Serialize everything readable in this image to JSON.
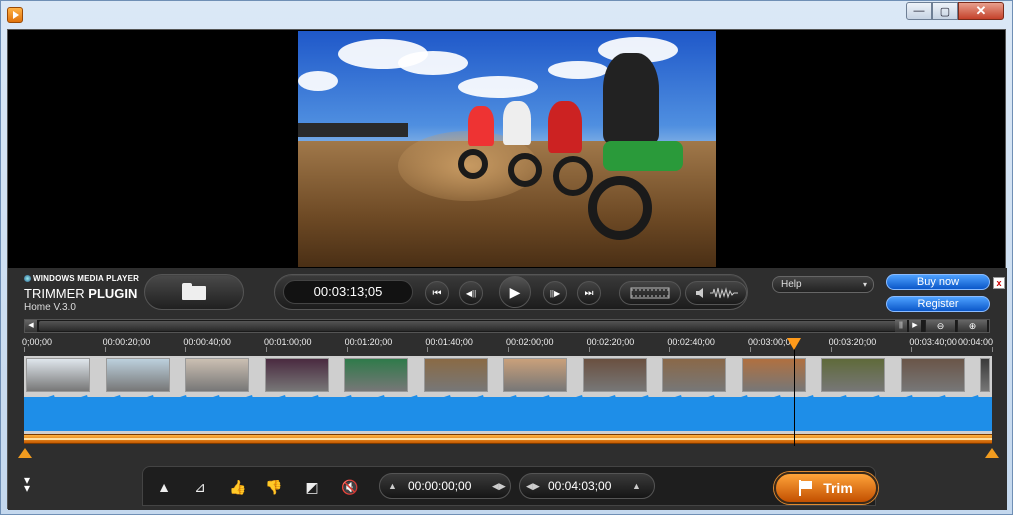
{
  "window": {
    "minimize_glyph": "—",
    "maximize_glyph": "▢",
    "close_glyph": "✕",
    "app_icon": "play-icon"
  },
  "branding": {
    "small": "WINDOWS MEDIA PLAYER",
    "title_light": "TRIMMER ",
    "title_bold": "PLUGIN",
    "version": "Home V.3.0"
  },
  "player": {
    "timecode": "00:03:13;05",
    "open_icon": "folder-icon"
  },
  "transport": {
    "skip_back": "⏮",
    "step_back": "◀||",
    "play": "▶",
    "step_forward": "||▶",
    "skip_forward": "⏭",
    "frame_mode_icon": "filmstrip-icon",
    "audio_mode_icon": "waveform-icon"
  },
  "menu": {
    "help_label": "Help",
    "help_caret": "▾",
    "buy_label": "Buy now",
    "register_label": "Register",
    "close_label": "x"
  },
  "timeline": {
    "ruler_labels": [
      "0;00;00",
      "00:00:20;00",
      "00:00:40;00",
      "00:01:00;00",
      "00:01:20;00",
      "00:01:40;00",
      "00:02:00;00",
      "00:02:20;00",
      "00:02:40;00",
      "00:03:00;00",
      "00:03:20;00",
      "00:03:40;00",
      "00:04:00"
    ],
    "playhead_fraction": 0.795,
    "thumbnail_colors": [
      "#dfe6ec",
      "#bcd0dd",
      "#cbbfb2",
      "#4a2a40",
      "#2f7a4a",
      "#8a6a45",
      "#c9a07a",
      "#6a5040",
      "#8a6848",
      "#b07040",
      "#5f6a3a",
      "#6a5548",
      "#3a3a3a"
    ],
    "waveform_color": "#1e8ee8",
    "range_color": "#f29c1f"
  },
  "tools": {
    "start_timecode": "00:00:00;00",
    "end_timecode": "00:04:03;00",
    "icons": [
      "mark-in-icon",
      "clear-mark-icon",
      "thumbs-up-icon",
      "thumbs-down-icon",
      "snapshot-icon",
      "mute-icon"
    ]
  },
  "trim": {
    "label": "Trim"
  }
}
